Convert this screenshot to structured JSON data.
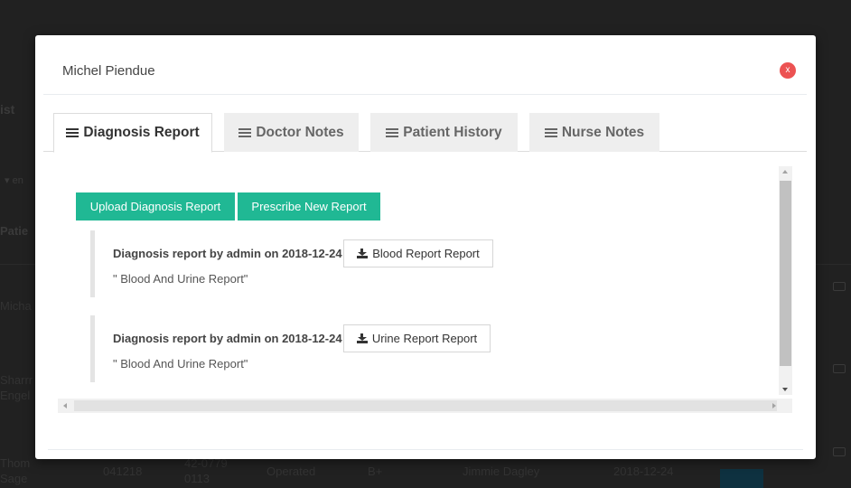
{
  "background": {
    "title_fragment": "ist",
    "filter_fragment": "▾ en",
    "header_fragment": "Patie",
    "rows": [
      {
        "name": "Micha"
      },
      {
        "name": "Sharrr Engel"
      },
      {
        "name": "Thom Sage",
        "id": "041218",
        "phone": "42-0779 0113",
        "status": "Operated",
        "blood": "B+",
        "doctor": "Jimmie Dagley",
        "date": "2018-12-24"
      }
    ]
  },
  "modal": {
    "title": "Michel Piendue",
    "close_label": "x",
    "tabs": [
      {
        "label": "Diagnosis Report",
        "active": true
      },
      {
        "label": "Doctor Notes",
        "active": false
      },
      {
        "label": "Patient History",
        "active": false
      },
      {
        "label": "Nurse Notes",
        "active": false
      }
    ],
    "actions": {
      "upload_label": "Upload Diagnosis Report",
      "prescribe_label": "Prescribe New Report"
    },
    "reports": [
      {
        "title": "Diagnosis report by admin on 2018-12-24",
        "download_label": "Blood Report Report",
        "description": "\" Blood And Urine Report\""
      },
      {
        "title": "Diagnosis report by admin on 2018-12-24",
        "download_label": "Urine Report Report",
        "description": "\" Blood And Urine Report\""
      }
    ]
  },
  "colors": {
    "accent": "#20b894",
    "close": "#ec5252",
    "overlay": "#212121"
  }
}
